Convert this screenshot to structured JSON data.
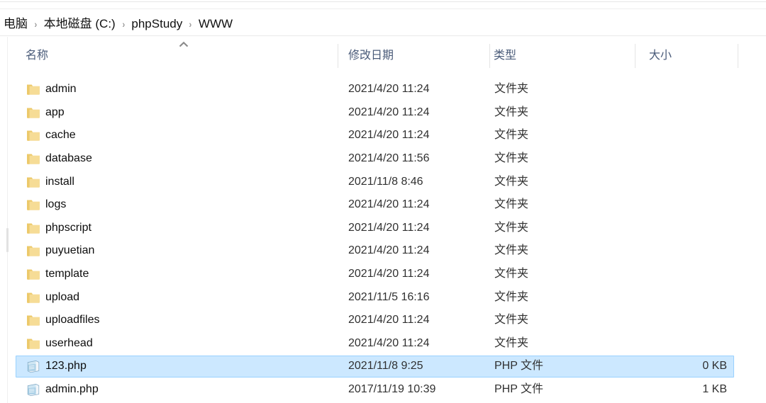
{
  "window": {
    "title": "WWW"
  },
  "breadcrumb": {
    "separator": "›",
    "items": [
      {
        "label": "电脑"
      },
      {
        "label": "本地磁盘 (C:)"
      },
      {
        "label": "phpStudy"
      },
      {
        "label": "WWW"
      }
    ]
  },
  "columns": {
    "name": "名称",
    "date_modified": "修改日期",
    "type": "类型",
    "size": "大小",
    "sort_column": "名称",
    "sort_direction": "ascending",
    "sort_icon": "chevron-up-icon"
  },
  "colors": {
    "selection_fill": "#cce8ff",
    "selection_border": "#99d1ff",
    "folder_icon": "#f5d98a",
    "header_text": "#4a5b79"
  },
  "rows": [
    {
      "icon": "folder-icon",
      "name": "admin",
      "date": "2021/4/20 11:24",
      "type": "文件夹",
      "size": "",
      "selected": false
    },
    {
      "icon": "folder-icon",
      "name": "app",
      "date": "2021/4/20 11:24",
      "type": "文件夹",
      "size": "",
      "selected": false
    },
    {
      "icon": "folder-icon",
      "name": "cache",
      "date": "2021/4/20 11:24",
      "type": "文件夹",
      "size": "",
      "selected": false
    },
    {
      "icon": "folder-icon",
      "name": "database",
      "date": "2021/4/20 11:56",
      "type": "文件夹",
      "size": "",
      "selected": false
    },
    {
      "icon": "folder-icon",
      "name": "install",
      "date": "2021/11/8 8:46",
      "type": "文件夹",
      "size": "",
      "selected": false
    },
    {
      "icon": "folder-icon",
      "name": "logs",
      "date": "2021/4/20 11:24",
      "type": "文件夹",
      "size": "",
      "selected": false
    },
    {
      "icon": "folder-icon",
      "name": "phpscript",
      "date": "2021/4/20 11:24",
      "type": "文件夹",
      "size": "",
      "selected": false
    },
    {
      "icon": "folder-icon",
      "name": "puyuetian",
      "date": "2021/4/20 11:24",
      "type": "文件夹",
      "size": "",
      "selected": false
    },
    {
      "icon": "folder-icon",
      "name": "template",
      "date": "2021/4/20 11:24",
      "type": "文件夹",
      "size": "",
      "selected": false
    },
    {
      "icon": "folder-icon",
      "name": "upload",
      "date": "2021/11/5 16:16",
      "type": "文件夹",
      "size": "",
      "selected": false
    },
    {
      "icon": "folder-icon",
      "name": "uploadfiles",
      "date": "2021/4/20 11:24",
      "type": "文件夹",
      "size": "",
      "selected": false
    },
    {
      "icon": "folder-icon",
      "name": "userhead",
      "date": "2021/4/20 11:24",
      "type": "文件夹",
      "size": "",
      "selected": false
    },
    {
      "icon": "php-file-icon",
      "name": "123.php",
      "date": "2021/11/8 9:25",
      "type": "PHP 文件",
      "size": "0 KB",
      "selected": true
    },
    {
      "icon": "php-file-icon",
      "name": "admin.php",
      "date": "2017/11/19 10:39",
      "type": "PHP 文件",
      "size": "1 KB",
      "selected": false
    }
  ]
}
